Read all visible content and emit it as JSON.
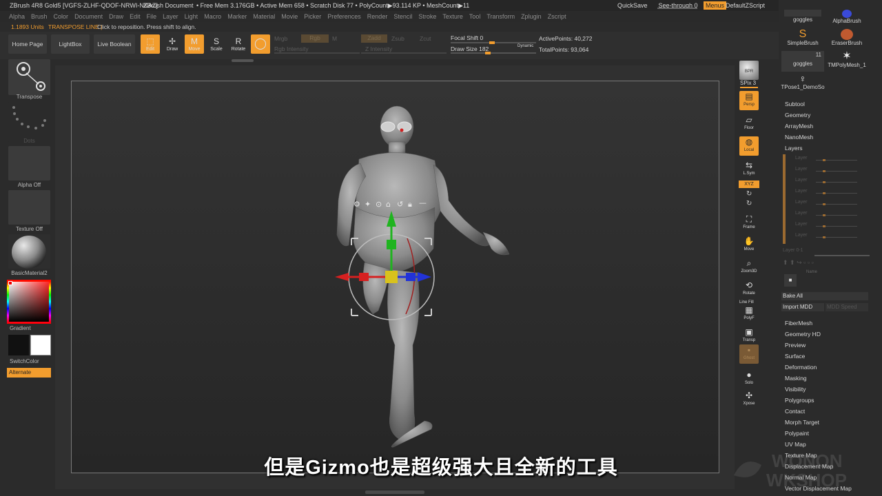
{
  "titlebar": {
    "app": "ZBrush 4R8 Gold5 [VGFS-ZLHF-QDOF-NRWI-NKAZ]",
    "document": "ZBrush Document",
    "stats": "• Free Mem 3.176GB • Active Mem 658 • Scratch Disk 77 • PolyCount▶93.114 KP • MeshCount▶11",
    "quicksave": "QuickSave",
    "see_through": "See-through 0",
    "menus": "Menus",
    "script": "DefaultZScript"
  },
  "menubar": [
    "Alpha",
    "Brush",
    "Color",
    "Document",
    "Draw",
    "Edit",
    "File",
    "Layer",
    "Light",
    "Macro",
    "Marker",
    "Material",
    "Movie",
    "Picker",
    "Preferences",
    "Render",
    "Stencil",
    "Stroke",
    "Texture",
    "Tool",
    "Transform",
    "Zplugin",
    "Zscript"
  ],
  "infobar": {
    "units": "1.1893 Units",
    "mode": "TRANSPOSE LINE |",
    "hint": "Click to reposition. Press shift to align."
  },
  "toolbar": {
    "home": "Home Page",
    "lightbox": "LightBox",
    "live_boolean": "Live Boolean",
    "edit": "Edit",
    "draw": "Draw",
    "move": "Move",
    "scale": "Scale",
    "rotate": "Rotate",
    "mrgb": "Mrgb",
    "rgb": "Rgb",
    "m": "M",
    "zadd": "Zadd",
    "zsub": "Zsub",
    "zcut": "Zcut",
    "rgb_intensity": "Rgb Intensity",
    "z_intensity": "Z Intensity",
    "focal_shift": "Focal Shift 0",
    "draw_size": "Draw Size 182",
    "dynamic": "Dynamic",
    "active_points": "ActivePoints: 40,272",
    "total_points": "TotalPoints: 93,064"
  },
  "leftshelf": {
    "transpose": "Transpose",
    "dots": "Dots",
    "alpha": "Alpha Off",
    "texture": "Texture Off",
    "material": "BasicMaterial2",
    "gradient": "Gradient",
    "switch": "SwitchColor",
    "alternate": "Alternate"
  },
  "rightshelf": {
    "bpr": "BPR",
    "spix": "SPix 3",
    "persp": "Persp",
    "floor": "Floor",
    "local": "Local",
    "lsym": "L.Sym",
    "xyz": "XYZ",
    "frame": "Frame",
    "move": "Move",
    "zoom3d": "Zoom3D",
    "rotate": "Rotate",
    "linefill": "Line Fill",
    "polyf": "PolyF",
    "transp": "Transp",
    "ghost": "Ghost",
    "solo": "Solo",
    "xpose": "Xpose"
  },
  "tray": {
    "brushes": [
      {
        "label": "goggles"
      },
      {
        "label": "AlphaBrush"
      },
      {
        "label": "SimpleBrush"
      },
      {
        "label": "EraserBrush"
      },
      {
        "label": "goggles",
        "count": "11"
      },
      {
        "label": "TMPolyMesh_1"
      },
      {
        "label": "TPose1_DemoSo"
      }
    ],
    "menu_top": [
      "Subtool",
      "Geometry",
      "ArrayMesh",
      "NanoMesh",
      "Layers"
    ],
    "layers": [
      "Layer",
      "Layer",
      "Layer",
      "Layer",
      "Layer",
      "Layer",
      "Layer",
      "Layer"
    ],
    "layer_count": "Layer 0-1",
    "name_btn": "Name",
    "bake_all": "Bake All",
    "import_mdd": "Import MDD",
    "mdd_speed": "MDD Speed",
    "menu_bottom": [
      "FiberMesh",
      "Geometry HD",
      "Preview",
      "Surface",
      "Deformation",
      "Masking",
      "Visibility",
      "Polygroups",
      "Contact",
      "Morph Target",
      "Polypaint",
      "UV Map",
      "Texture Map",
      "Displacement Map",
      "Normal Map",
      "Vector Displacement Map"
    ]
  },
  "subtitle": "但是Gizmo也是超级强大且全新的工具",
  "watermark": "Wonderful Workshop",
  "colors": {
    "accent": "#f29d2e",
    "bg": "#2b2b2b"
  }
}
